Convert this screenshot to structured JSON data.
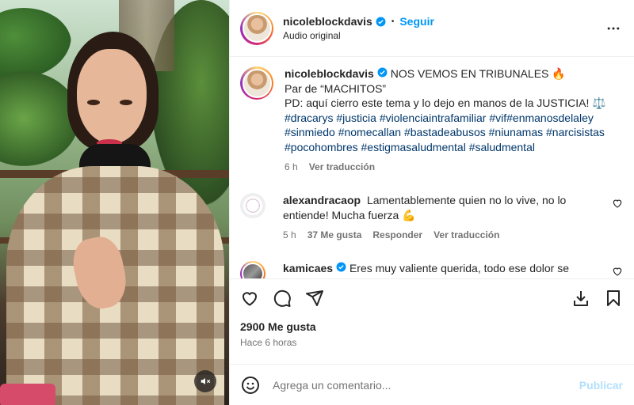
{
  "header": {
    "username": "nicoleblockdavis",
    "separator": "•",
    "follow_label": "Seguir",
    "subtitle": "Audio original",
    "more_icon": "more-horizontal-icon"
  },
  "caption": {
    "username": "nicoleblockdavis",
    "line1": "NOS VEMOS EN TRIBUNALES 🔥",
    "line2": "Par de “MACHITOS”",
    "line3": "PD: aquí cierro este tema y lo dejo en manos de la JUSTICIA! ⚖️",
    "hashtags": "#dracarys #justicia #violenciaintrafamiliar #vif#enmanosdelaley #sinmiedo #nomecallan #bastadeabusos #niunamas #narcisistas #pocohombres #estigmasaludmental #saludmental",
    "time": "6 h",
    "translate": "Ver traducción"
  },
  "comments": [
    {
      "username": "alexandracaop",
      "text": "Lamentablemente quien no lo vive, no lo entiende! Mucha fuerza 💪",
      "time": "5 h",
      "likes": "37 Me gusta",
      "reply": "Responder",
      "translate": "Ver traducción"
    },
    {
      "username": "kamicaes",
      "text": "Eres muy valiente querida, todo ese dolor se"
    }
  ],
  "actions": {
    "likes": "2900 Me gusta",
    "posted": "Hace 6 horas"
  },
  "add_comment": {
    "placeholder": "Agrega un comentario...",
    "publish": "Publicar"
  },
  "colors": {
    "accent": "#0095f6",
    "hashtag": "#00376b",
    "muted": "#737373",
    "publish_disabled": "#b2dffc"
  }
}
